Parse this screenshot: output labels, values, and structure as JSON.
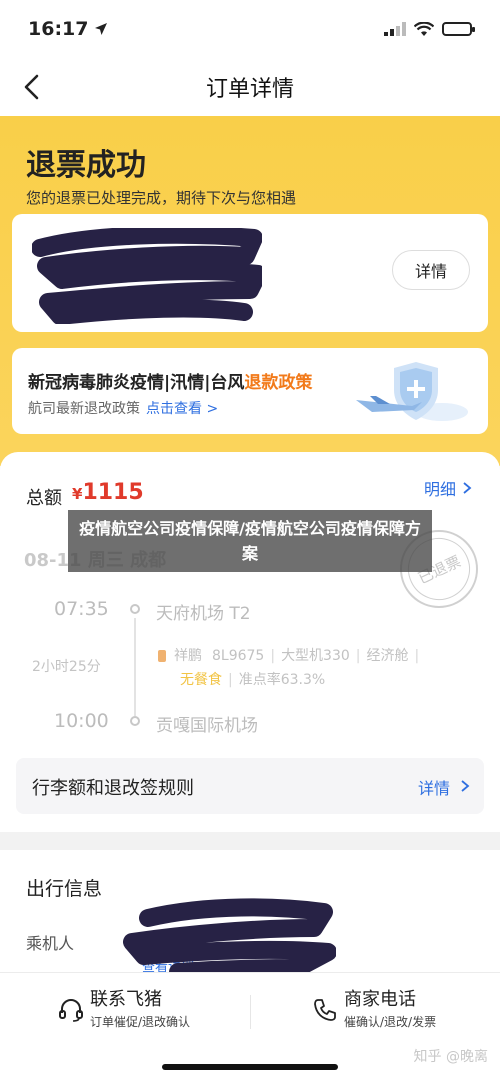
{
  "status_bar": {
    "time": "16:17"
  },
  "nav": {
    "title": "订单详情"
  },
  "header": {
    "title": "退票成功",
    "subtitle": "您的退票已处理完成，期待下次与您相遇",
    "detail_button": "详情"
  },
  "policy": {
    "title_main": "新冠病毒肺炎疫情|汛情|台风",
    "title_highlight": "退款政策",
    "subtitle": "航司最新退改政策",
    "link": "点击查看 >"
  },
  "order": {
    "total_label": "总额",
    "currency": "¥",
    "total_amount": "1115",
    "detail_link": "明细",
    "date_peek": "08-11 周三 成都",
    "stamp": "已退票",
    "depart_time": "07:35",
    "depart_airport": "天府机场 T2",
    "duration": "2小时25分",
    "airline": "祥鹏",
    "flight_no": "8L9675",
    "aircraft": "大型机330",
    "cabin": "经济舱",
    "meal": "无餐食",
    "on_time": "准点率63.3%",
    "arrive_time": "10:00",
    "arrive_airport": "贡嘎国际机场",
    "rules_label": "行李额和退改签规则",
    "rules_link": "详情"
  },
  "travel": {
    "title": "出行信息",
    "passenger_label": "乘机人",
    "view_detail": "查看详细"
  },
  "overlay": {
    "text": "疫情航空公司疫情保障/疫情航空公司疫情保障方案"
  },
  "bottom_bar": {
    "contact_title": "联系飞猪",
    "contact_sub": "订单催促/退改确认",
    "merchant_title": "商家电话",
    "merchant_sub": "催确认/退改/发票"
  },
  "watermark": "知乎 @晚离",
  "colors": {
    "yellow": "#f9cf49",
    "price_red": "#e03a2b",
    "link_blue": "#2f6fe0",
    "policy_orange": "#f27a1a"
  }
}
